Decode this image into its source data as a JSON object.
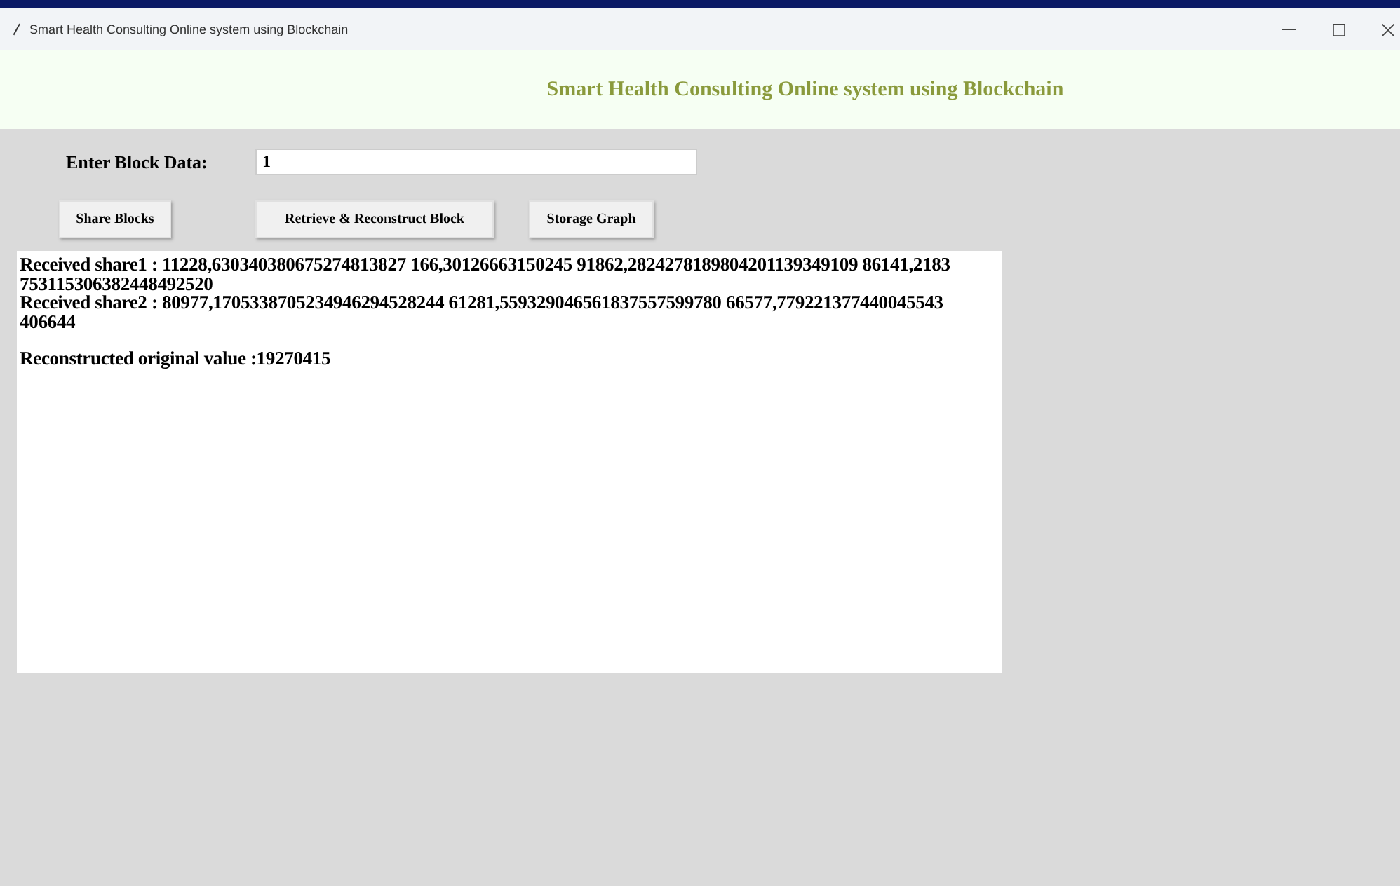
{
  "window": {
    "title": "Smart Health Consulting Online system using Blockchain"
  },
  "header": {
    "title": "Smart Health Consulting Online system using Blockchain"
  },
  "form": {
    "label": "Enter Block Data:",
    "value": "1"
  },
  "buttons": [
    "Share Blocks",
    "Retrieve & Reconstruct Block",
    "Storage Graph"
  ],
  "output": {
    "paragraphs": [
      {
        "lines": [
          "Received share1 : 11228,630340380675274813827 166,30126663150245 91862,2824278189804201139349109 86141,2183",
          "753115306382448492520",
          "Received share2 : 80977,1705338705234946294528244 61281,559329046561837557599780 66577,779221377440045543",
          "406644"
        ]
      },
      {
        "lines": [
          "Reconstructed original value :19270415"
        ]
      }
    ]
  }
}
